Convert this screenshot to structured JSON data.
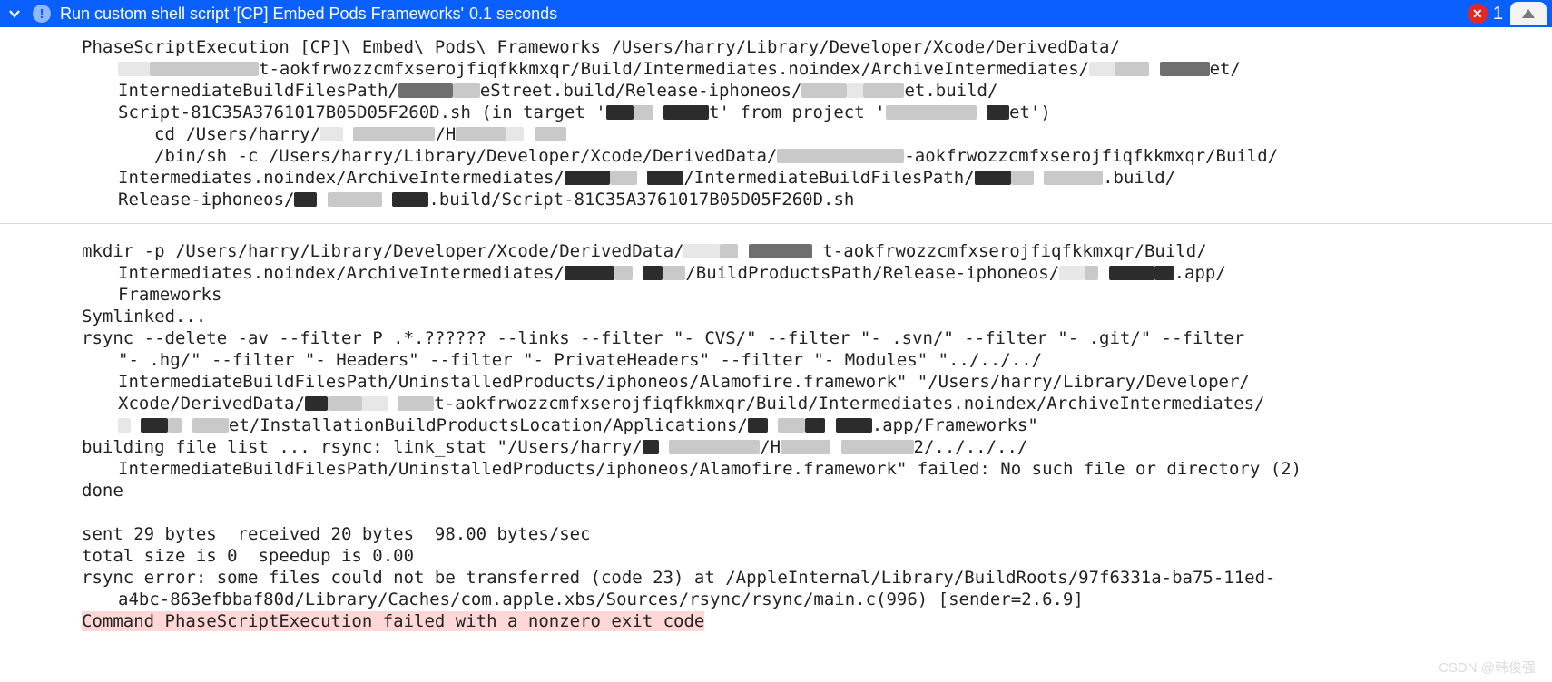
{
  "header": {
    "title": "Run custom shell script '[CP] Embed Pods Frameworks'",
    "duration": "0.1 seconds",
    "error_count": "1"
  },
  "log": {
    "l1": "PhaseScriptExecution [CP]\\ Embed\\ Pods\\ Frameworks /Users/harry/Library/Developer/Xcode/DerivedData/",
    "l2a": "t-aokfrwozzcmfxserojfiqfkkmxqr/Build/Intermediates.noindex/ArchiveIntermediates/",
    "l2b": "et/",
    "l3a": "InternediateBuildFilesPath/",
    "l3b": "eStreet.build/Release-iphoneos/",
    "l3c": "et.build/",
    "l4a": "Script-81C35A3761017B05D05F260D.sh (in target '",
    "l4b": "t' from project '",
    "l4c": "et')",
    "l5a": "cd /Users/harry/",
    "l5b": "/H",
    "l6a": "/bin/sh -c /Users/harry/Library/Developer/Xcode/DerivedData/",
    "l6b": "-aokfrwozzcmfxserojfiqfkkmxqr/Build/",
    "l7a": "Intermediates.noindex/ArchiveIntermediates/",
    "l7b": "/IntermediateBuildFilesPath/",
    "l7c": ".build/",
    "l8a": "Release-iphoneos/",
    "l8b": ".build/Script-81C35A3761017B05D05F260D.sh",
    "m1a": "mkdir -p /Users/harry/Library/Developer/Xcode/DerivedData/",
    "m1b": "t-aokfrwozzcmfxserojfiqfkkmxqr/Build/",
    "m2a": "Intermediates.noindex/ArchiveIntermediates/",
    "m2b": "/BuildProductsPath/Release-iphoneos/",
    "m2c": ".app/",
    "m3": "Frameworks",
    "m4": "Symlinked...",
    "m5": "rsync --delete -av --filter P .*.?????? --links --filter \"- CVS/\" --filter \"- .svn/\" --filter \"- .git/\" --filter",
    "m6": "\"- .hg/\" --filter \"- Headers\" --filter \"- PrivateHeaders\" --filter \"- Modules\" \"../../../",
    "m7": "IntermediateBuildFilesPath/UninstalledProducts/iphoneos/Alamofire.framework\" \"/Users/harry/Library/Developer/",
    "m8a": "Xcode/DerivedData/",
    "m8b": "t-aokfrwozzcmfxserojfiqfkkmxqr/Build/Intermediates.noindex/ArchiveIntermediates/",
    "m9a": "et/InstallationBuildProductsLocation/Applications/",
    "m9b": ".app/Frameworks\"",
    "m10a": "building file list ... rsync: link_stat \"/Users/harry/",
    "m10b": "/H",
    "m10c": "2/../../../",
    "m11": "IntermediateBuildFilesPath/UninstalledProducts/iphoneos/Alamofire.framework\" failed: No such file or directory (2)",
    "m12": "done",
    "s1": "sent 29 bytes  received 20 bytes  98.00 bytes/sec",
    "s2": "total size is 0  speedup is 0.00",
    "s3": "rsync error: some files could not be transferred (code 23) at /AppleInternal/Library/BuildRoots/97f6331a-ba75-11ed-",
    "s4": "a4bc-863efbbaf80d/Library/Caches/com.apple.xbs/Sources/rsync/rsync/main.c(996) [sender=2.6.9]",
    "s5": "Command PhaseScriptExecution failed with a nonzero exit code"
  },
  "watermark": "CSDN @韩俊强"
}
